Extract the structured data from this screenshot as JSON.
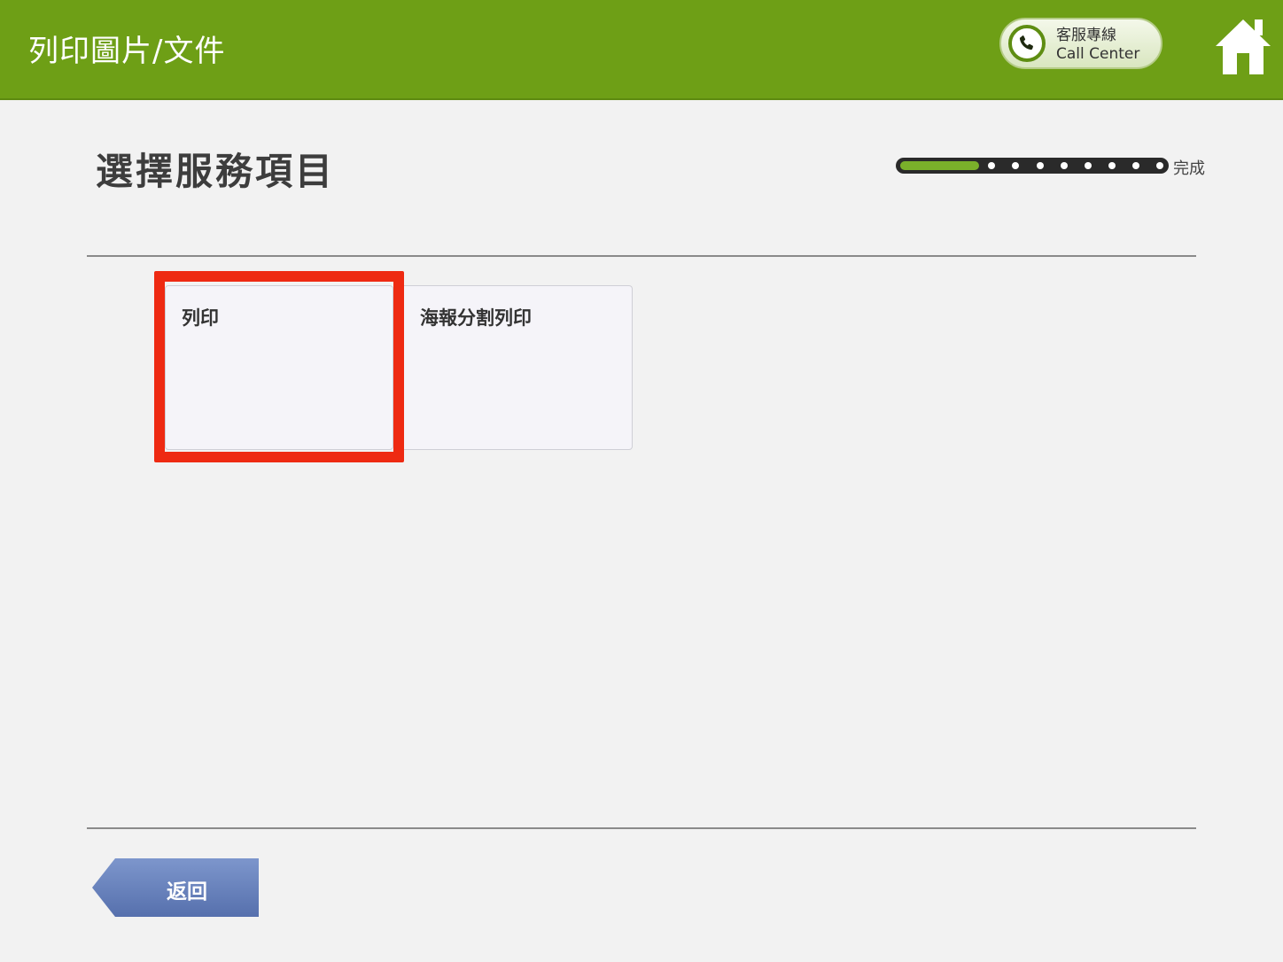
{
  "header": {
    "title": "列印圖片/文件",
    "call_center_zh": "客服專線",
    "call_center_en": "Call Center",
    "background_color": "#6e9f16"
  },
  "main": {
    "title": "選擇服務項目",
    "progress_label": "完成",
    "progress_fraction": 0.3,
    "progress_steps": 10,
    "progress_color": "#7ab02a"
  },
  "services": [
    {
      "label": "列印",
      "selected": true
    },
    {
      "label": "海報分割列印",
      "selected": false
    }
  ],
  "footer": {
    "back_label": "返回",
    "back_color": "#5b78b5"
  },
  "highlight_color": "#ee2a12"
}
